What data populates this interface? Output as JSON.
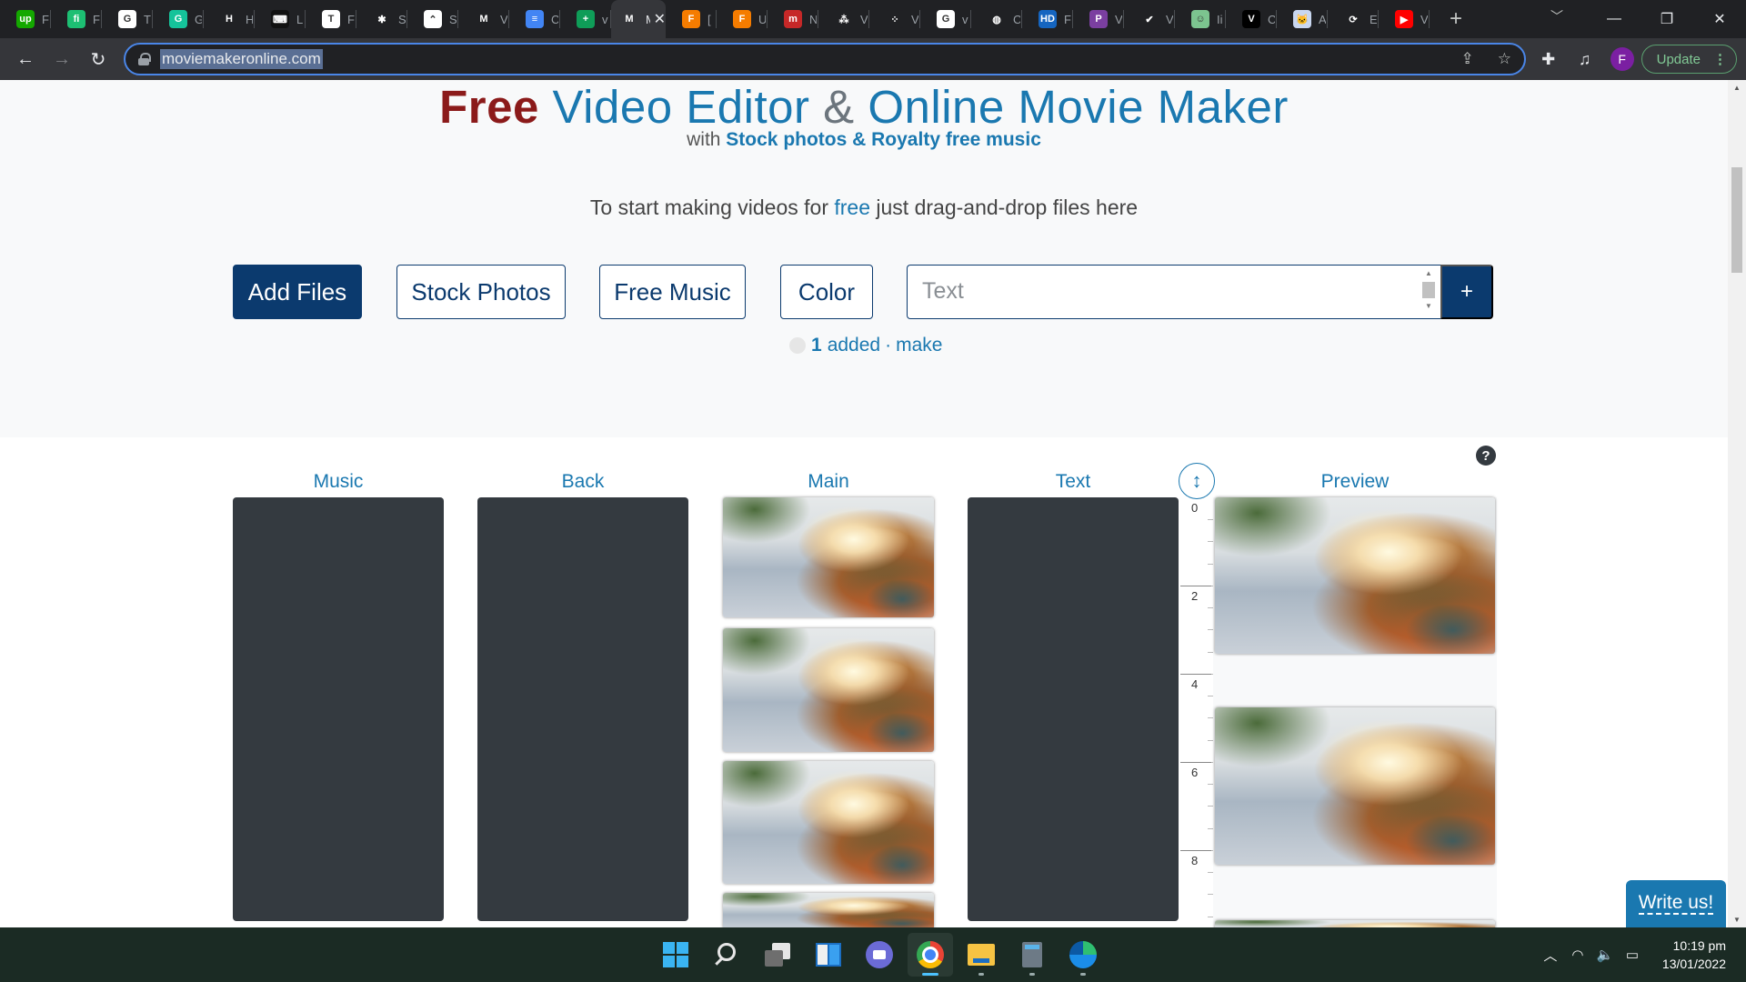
{
  "browser": {
    "tabs": [
      {
        "icon": "upwork-icon",
        "glyph": "up",
        "color": "#14a800",
        "title": "F"
      },
      {
        "icon": "fiverr-icon",
        "glyph": "fi",
        "color": "#1dbf73",
        "title": "F"
      },
      {
        "icon": "google-icon",
        "glyph": "G",
        "color": "#ffffff",
        "title": "T"
      },
      {
        "icon": "grammarly-icon",
        "glyph": "G",
        "color": "#15c39a",
        "title": "G"
      },
      {
        "icon": "serif-h-icon",
        "glyph": "H",
        "color": "#202124",
        "title": "H"
      },
      {
        "icon": "typewriter-icon",
        "glyph": "⌨",
        "color": "#111111",
        "title": "L"
      },
      {
        "icon": "letter-t-icon",
        "glyph": "T",
        "color": "#ffffff",
        "title": "F"
      },
      {
        "icon": "slack-icon",
        "glyph": "✱",
        "color": "#202124",
        "title": "S"
      },
      {
        "icon": "clickup-icon",
        "glyph": "⌃",
        "color": "#ffffff",
        "title": "S"
      },
      {
        "icon": "gmail-icon",
        "glyph": "M",
        "color": "#202124",
        "title": "V"
      },
      {
        "icon": "google-docs-icon",
        "glyph": "≡",
        "color": "#4285f4",
        "title": "C"
      },
      {
        "icon": "google-sheets-plus-icon",
        "glyph": "+",
        "color": "#0f9d58",
        "title": "v"
      },
      {
        "icon": "moviemaker-icon",
        "glyph": "M",
        "color": "#35363a",
        "title": "M",
        "active": true
      },
      {
        "icon": "f-orange-icon",
        "glyph": "F",
        "color": "#f57c00",
        "title": "["
      },
      {
        "icon": "f-orange-icon",
        "glyph": "F",
        "color": "#f57c00",
        "title": "U"
      },
      {
        "icon": "mega-icon",
        "glyph": "m",
        "color": "#c62828",
        "title": "N"
      },
      {
        "icon": "dots-icon",
        "glyph": "⁂",
        "color": "#202124",
        "title": "V"
      },
      {
        "icon": "diamond-dots-icon",
        "glyph": "⁘",
        "color": "#202124",
        "title": "V"
      },
      {
        "icon": "google-icon",
        "glyph": "G",
        "color": "#ffffff",
        "title": "v"
      },
      {
        "icon": "dark-shield-icon",
        "glyph": "◍",
        "color": "#202124",
        "title": "C"
      },
      {
        "icon": "hd-icon",
        "glyph": "HD",
        "color": "#1565c0",
        "title": "F"
      },
      {
        "icon": "p-square-icon",
        "glyph": "P",
        "color": "#7b3fa0",
        "title": "V"
      },
      {
        "icon": "check-v-icon",
        "glyph": "✔",
        "color": "#202124",
        "title": "V"
      },
      {
        "icon": "green-face-icon",
        "glyph": "☺",
        "color": "#7cc48f",
        "title": "Ii"
      },
      {
        "icon": "v-black-icon",
        "glyph": "V",
        "color": "#000000",
        "title": "C"
      },
      {
        "icon": "cat-icon",
        "glyph": "🐱",
        "color": "#c9d7f0",
        "title": "A"
      },
      {
        "icon": "refresh-arrows-icon",
        "glyph": "⟳",
        "color": "#202124",
        "title": "E"
      },
      {
        "icon": "youtube-icon",
        "glyph": "▶",
        "color": "#ff0000",
        "title": "V"
      }
    ],
    "new_tab": "+",
    "url": "moviemakeronline.com",
    "profile_initial": "F",
    "update_label": "Update"
  },
  "page": {
    "title": {
      "free": "Free",
      "part1": " Video Editor ",
      "amp": "&",
      "part2": " Online Movie Maker"
    },
    "subtitle": {
      "prefix": "with ",
      "highlight": "Stock photos & Royalty free music"
    },
    "prompt": {
      "before": "To start making videos for ",
      "highlight": "free",
      "after": " just drag-and-drop files here"
    },
    "buttons": {
      "add_files": "Add Files",
      "stock_photos": "Stock Photos",
      "free_music": "Free Music",
      "color": "Color",
      "add": "+"
    },
    "text_input": {
      "value": "",
      "placeholder": "Text"
    },
    "status": {
      "count": "1",
      "added": "added",
      "separator": "·",
      "make": "make"
    },
    "timeline": {
      "columns": [
        "Music",
        "Back",
        "Main",
        "Text",
        "Preview"
      ],
      "ruler_labels": [
        "0",
        "2",
        "4",
        "6",
        "8"
      ],
      "help": "?",
      "zoom_icon": "↕"
    },
    "write_us": "Write us!"
  },
  "taskbar": {
    "time": "10:19 pm",
    "date": "13/01/2022"
  }
}
